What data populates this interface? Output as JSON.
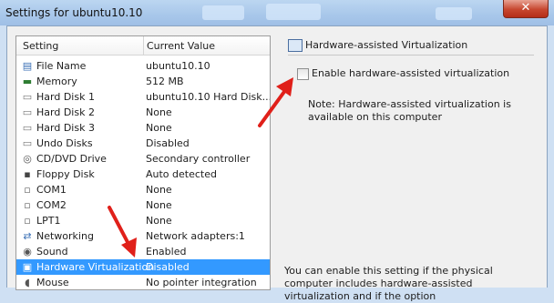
{
  "window": {
    "title": "Settings for ubuntu10.10",
    "close_glyph": "✕"
  },
  "list": {
    "headers": {
      "setting": "Setting",
      "value": "Current Value"
    },
    "rows": [
      {
        "icon": "file-icon",
        "glyph": "▤",
        "color": "#3a6fb5",
        "name": "File Name",
        "value": "ubuntu10.10"
      },
      {
        "icon": "memory-icon",
        "glyph": "▬",
        "color": "#2e7d32",
        "name": "Memory",
        "value": "512 MB"
      },
      {
        "icon": "hard-disk-icon",
        "glyph": "▭",
        "color": "#777777",
        "name": "Hard Disk 1",
        "value": "ubuntu10.10 Hard Disk...."
      },
      {
        "icon": "hard-disk-icon",
        "glyph": "▭",
        "color": "#777777",
        "name": "Hard Disk 2",
        "value": "None"
      },
      {
        "icon": "hard-disk-icon",
        "glyph": "▭",
        "color": "#777777",
        "name": "Hard Disk 3",
        "value": "None"
      },
      {
        "icon": "undo-disk-icon",
        "glyph": "▭",
        "color": "#777777",
        "name": "Undo Disks",
        "value": "Disabled"
      },
      {
        "icon": "cd-dvd-icon",
        "glyph": "◎",
        "color": "#555555",
        "name": "CD/DVD Drive",
        "value": "Secondary controller"
      },
      {
        "icon": "floppy-icon",
        "glyph": "▪",
        "color": "#444444",
        "name": "Floppy Disk",
        "value": "Auto detected"
      },
      {
        "icon": "serial-port-icon",
        "glyph": "▫",
        "color": "#666666",
        "name": "COM1",
        "value": "None"
      },
      {
        "icon": "serial-port-icon",
        "glyph": "▫",
        "color": "#666666",
        "name": "COM2",
        "value": "None"
      },
      {
        "icon": "parallel-port-icon",
        "glyph": "▫",
        "color": "#666666",
        "name": "LPT1",
        "value": "None"
      },
      {
        "icon": "network-icon",
        "glyph": "⇄",
        "color": "#3a6fb5",
        "name": "Networking",
        "value": "Network adapters:1"
      },
      {
        "icon": "sound-icon",
        "glyph": "◉",
        "color": "#555555",
        "name": "Sound",
        "value": "Enabled"
      },
      {
        "icon": "virtualization-icon",
        "glyph": "▣",
        "color": "#ffffff",
        "name": "Hardware Virtualization",
        "value": "Disabled",
        "selected": true
      },
      {
        "icon": "mouse-icon",
        "glyph": "◖",
        "color": "#555555",
        "name": "Mouse",
        "value": "No pointer integration"
      }
    ]
  },
  "detail": {
    "heading": "Hardware-assisted Virtualization",
    "checkbox_label": "Enable hardware-assisted virtualization",
    "checkbox_checked": false,
    "note": "Note: Hardware-assisted virtualization is available on this computer",
    "bottom_text": "You can enable this setting if the physical computer includes hardware-assisted virtualization and if the option"
  },
  "colors": {
    "selection": "#3399ff",
    "annotation_arrow": "#e0201a"
  }
}
